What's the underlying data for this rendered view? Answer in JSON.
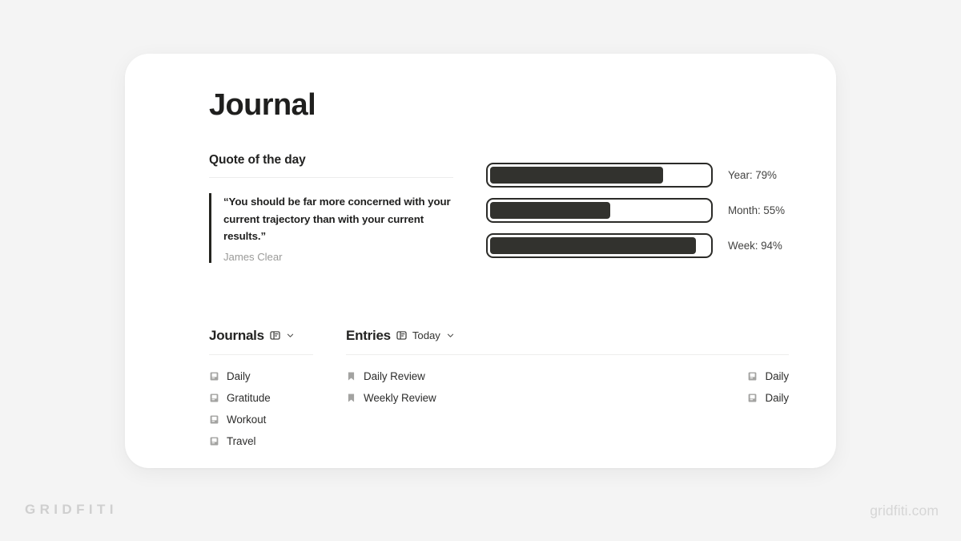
{
  "page": {
    "title": "Journal"
  },
  "quote_section": {
    "heading": "Quote of the day",
    "text": "“You should be far more concerned with your current trajectory than with your current results.”",
    "author": "James Clear"
  },
  "progress": {
    "bars": [
      {
        "label": "Year: 79%",
        "name": "Year",
        "percent": 79
      },
      {
        "label": "Month: 55%",
        "name": "Month",
        "percent": 55
      },
      {
        "label": "Week: 94%",
        "name": "Week",
        "percent": 94
      }
    ]
  },
  "journals_db": {
    "title": "Journals",
    "view_icon": "table-view-icon",
    "chevron_icon": "chevron-down-icon",
    "rows": [
      {
        "icon": "notebook-icon",
        "label": "Daily"
      },
      {
        "icon": "notebook-icon",
        "label": "Gratitude"
      },
      {
        "icon": "notebook-icon",
        "label": "Workout"
      },
      {
        "icon": "notebook-icon",
        "label": "Travel"
      }
    ]
  },
  "entries_db": {
    "title": "Entries",
    "view_icon": "table-view-icon",
    "view_name": "Today",
    "chevron_icon": "chevron-down-icon",
    "rows": [
      {
        "icon": "bookmark-icon",
        "label": "Daily Review",
        "relation_icon": "notebook-icon",
        "relation": "Daily"
      },
      {
        "icon": "bookmark-icon",
        "label": "Weekly Review",
        "relation_icon": "notebook-icon",
        "relation": "Daily"
      }
    ]
  },
  "watermark": {
    "left": "GRIDFITI",
    "right": "gridfiti.com"
  },
  "colors": {
    "background": "#f4f4f4",
    "card": "#ffffff",
    "ink": "#1f1f1e",
    "bar_fill": "#32322e",
    "muted": "#9b9b99"
  }
}
